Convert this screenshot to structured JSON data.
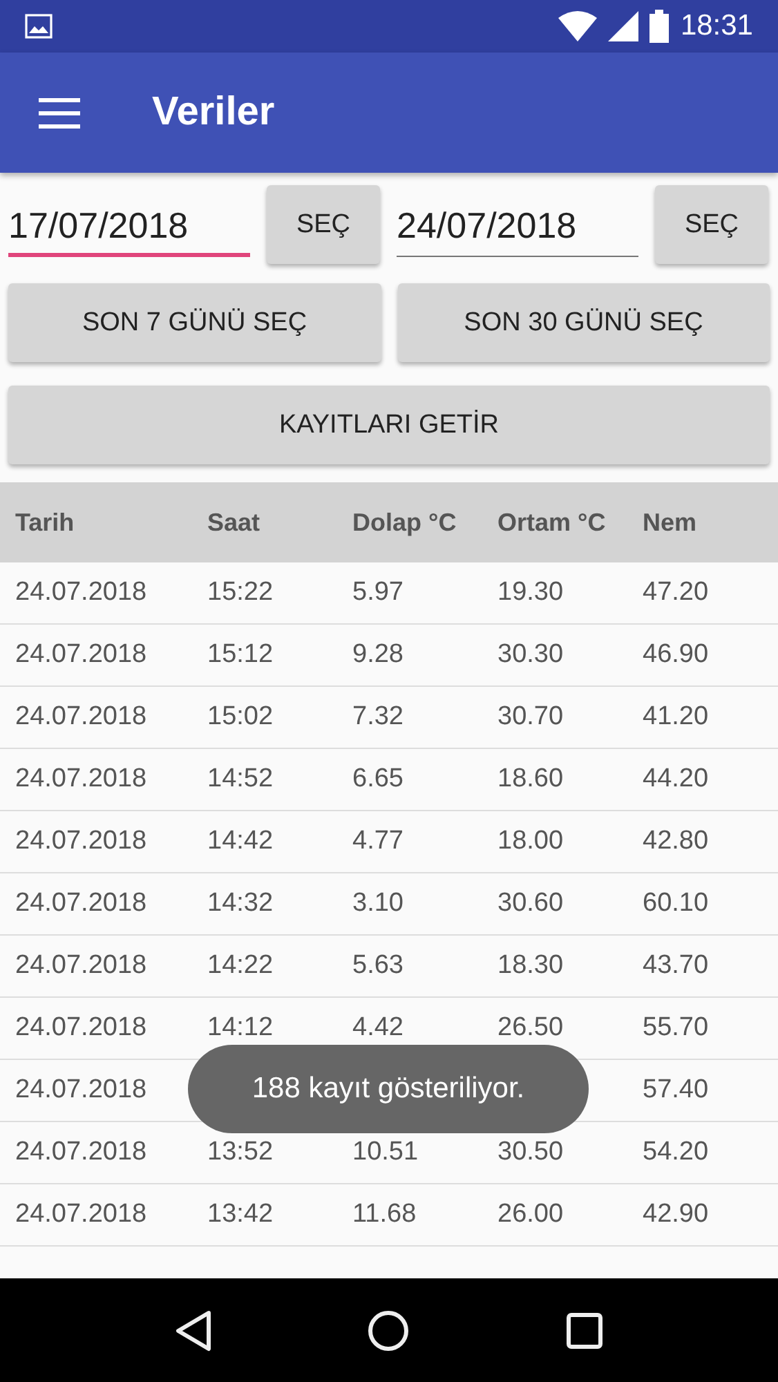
{
  "status_bar": {
    "time": "18:31"
  },
  "app_bar": {
    "title": "Veriler"
  },
  "date_fields": [
    {
      "value": "17/07/2018",
      "focused": true,
      "button": "SEÇ"
    },
    {
      "value": "24/07/2018",
      "focused": false,
      "button": "SEÇ"
    }
  ],
  "range_buttons": [
    "SON 7 GÜNÜ SEÇ",
    "SON 30 GÜNÜ SEÇ"
  ],
  "fetch_button": "KAYITLARI GETİR",
  "table": {
    "columns": [
      "Tarih",
      "Saat",
      "Dolap °C",
      "Ortam °C",
      "Nem"
    ],
    "rows": [
      {
        "tarih": "24.07.2018",
        "saat": "15:22",
        "dolap": "5.97",
        "ortam": "19.30",
        "nem": "47.20"
      },
      {
        "tarih": "24.07.2018",
        "saat": "15:12",
        "dolap": "9.28",
        "ortam": "30.30",
        "nem": "46.90"
      },
      {
        "tarih": "24.07.2018",
        "saat": "15:02",
        "dolap": "7.32",
        "ortam": "30.70",
        "nem": "41.20"
      },
      {
        "tarih": "24.07.2018",
        "saat": "14:52",
        "dolap": "6.65",
        "ortam": "18.60",
        "nem": "44.20"
      },
      {
        "tarih": "24.07.2018",
        "saat": "14:42",
        "dolap": "4.77",
        "ortam": "18.00",
        "nem": "42.80"
      },
      {
        "tarih": "24.07.2018",
        "saat": "14:32",
        "dolap": "3.10",
        "ortam": "30.60",
        "nem": "60.10"
      },
      {
        "tarih": "24.07.2018",
        "saat": "14:22",
        "dolap": "5.63",
        "ortam": "18.30",
        "nem": "43.70"
      },
      {
        "tarih": "24.07.2018",
        "saat": "14:12",
        "dolap": "4.42",
        "ortam": "26.50",
        "nem": "55.70"
      },
      {
        "tarih": "24.07.2018",
        "nem": "57.40"
      },
      {
        "tarih": "24.07.2018",
        "saat": "13:52",
        "dolap": "10.51",
        "ortam": "30.50",
        "nem": "54.20"
      },
      {
        "tarih": "24.07.2018",
        "saat": "13:42",
        "dolap": "11.68",
        "ortam": "26.00",
        "nem": "42.90"
      }
    ]
  },
  "toast": "188 kayıt gösteriliyor."
}
